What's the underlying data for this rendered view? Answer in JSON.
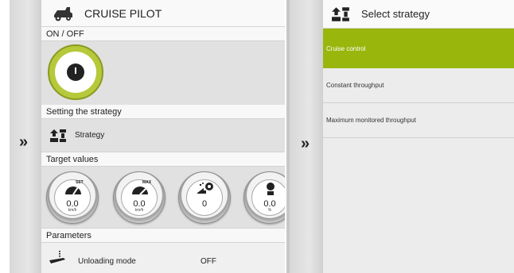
{
  "colors": {
    "accent": "#99b60d",
    "power_ring": "#b6c93a",
    "panel_bg": "#e1e1e1"
  },
  "left_panel": {
    "title": "CRUISE PILOT",
    "title_icon": "harvester-icon",
    "on_off_label": "ON / OFF",
    "setting_label": "Setting the strategy",
    "strategy_label": "Strategy",
    "target_label": "Target values",
    "gauges": [
      {
        "icon": "speed-set-icon",
        "tag": "SET",
        "value": "0.0",
        "unit": "km/h"
      },
      {
        "icon": "speed-max-icon",
        "tag": "MAX",
        "value": "0.0",
        "unit": "km/h"
      },
      {
        "icon": "throughput-icon",
        "tag": "",
        "value": "0",
        "unit": ""
      },
      {
        "icon": "loss-icon",
        "tag": "",
        "value": "0.0",
        "unit": "%"
      }
    ],
    "parameters_label": "Parameters",
    "param_label": "Unloading mode",
    "param_value": "OFF"
  },
  "right_panel": {
    "title": "Select strategy",
    "title_icon": "strategy-icon",
    "options": [
      "Cruise control",
      "Constant throughput",
      "Maximum monitored throughput"
    ],
    "selected_index": 0
  },
  "nav": {
    "chevron": "»"
  }
}
